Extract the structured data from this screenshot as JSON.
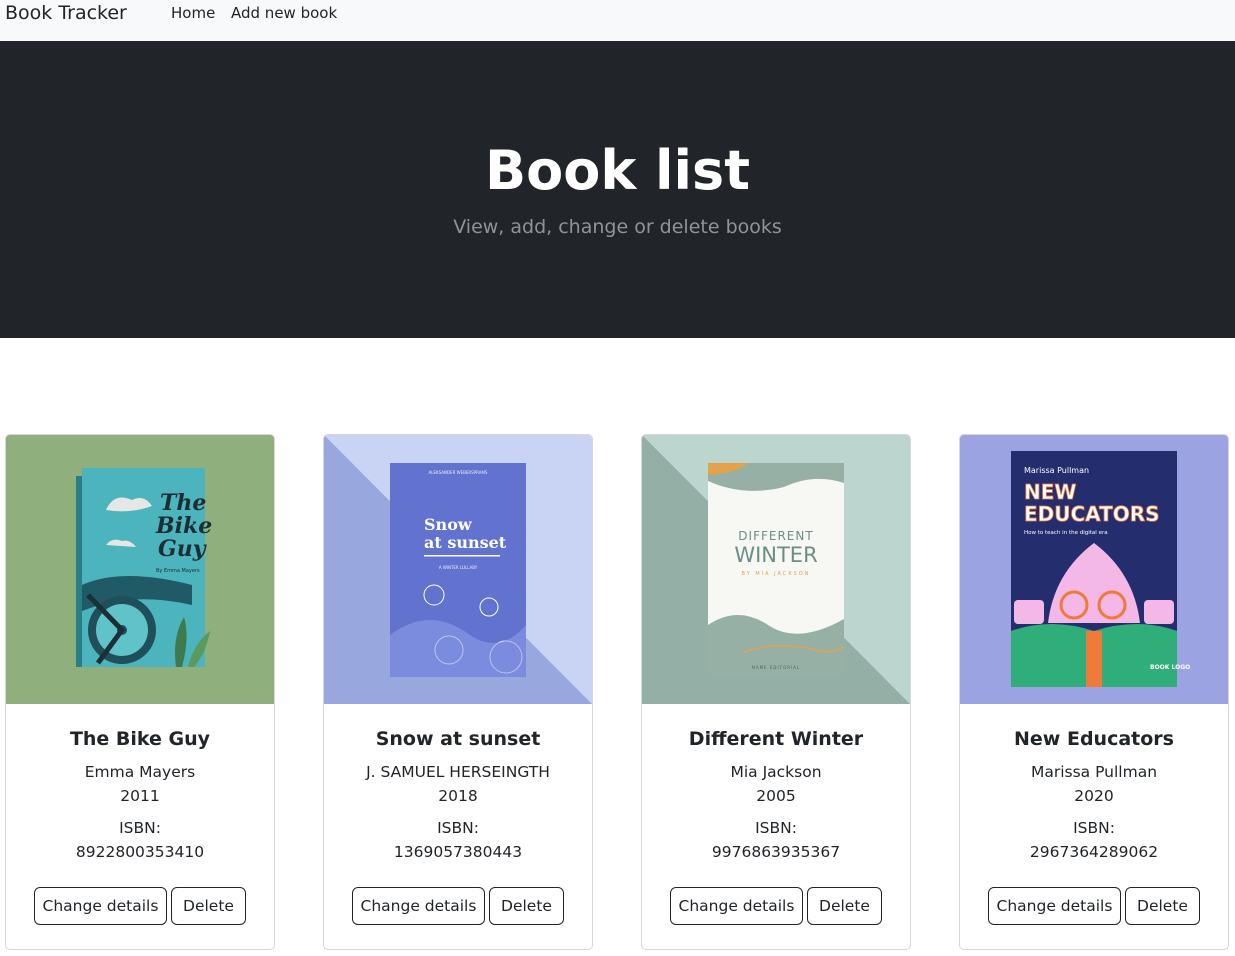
{
  "navbar": {
    "brand": "Book Tracker",
    "links": [
      "Home",
      "Add new book"
    ]
  },
  "hero": {
    "title": "Book list",
    "subtitle": "View, add, change or delete books"
  },
  "labels": {
    "isbn": "ISBN:",
    "change": "Change details",
    "delete": "Delete"
  },
  "books": [
    {
      "title": "The Bike Guy",
      "author": "Emma Mayers",
      "year": "2011",
      "isbn": "8922800353410",
      "cover": {
        "title_lines": [
          "The",
          "Bike",
          "Guy"
        ],
        "byline": "By Emma Mayers"
      }
    },
    {
      "title": "Snow at sunset",
      "author": "J. SAMUEL HERSEINGTH",
      "year": "2018",
      "isbn": "1369057380443",
      "cover": {
        "top": "ALEKSANDER WEBERSPRAMS",
        "title_lines": [
          "Snow",
          "at sunset"
        ],
        "byline": "A WINTER LULLABY"
      }
    },
    {
      "title": "Different Winter",
      "author": "Mia Jackson",
      "year": "2005",
      "isbn": "9976863935367",
      "cover": {
        "title_lines": [
          "DIFFERENT",
          "WINTER"
        ],
        "byline": "BY MIA JACKSON",
        "footer": "NAME EDITORIAL"
      }
    },
    {
      "title": "New Educators",
      "author": "Marissa Pullman",
      "year": "2020",
      "isbn": "2967364289062",
      "cover": {
        "author": "Marissa Pullman",
        "title_lines": [
          "NEW",
          "EDUCATORS"
        ],
        "tagline": "How to teach in the digital era",
        "logo": "BOOK LOGO"
      }
    }
  ]
}
